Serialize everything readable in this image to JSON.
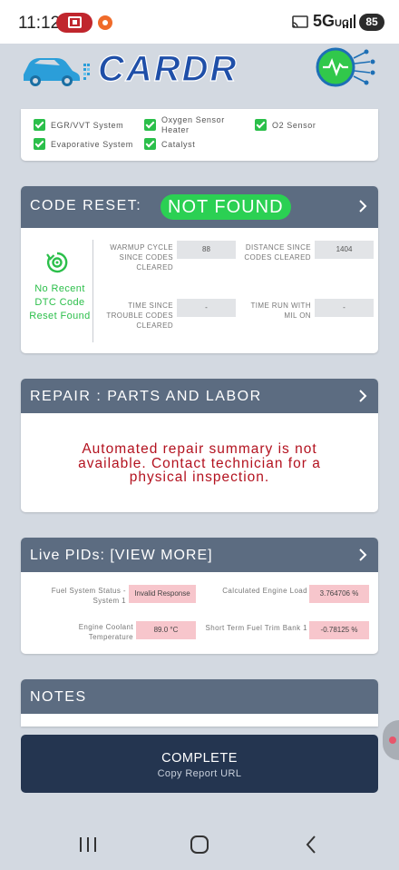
{
  "status_bar": {
    "time": "11:12",
    "network": "5G",
    "network_sub": "UC",
    "battery": "85"
  },
  "header": {
    "logo_text": "CARDR"
  },
  "monitors": [
    {
      "label": "EGR/VVT System"
    },
    {
      "label": "Oxygen Sensor Heater"
    },
    {
      "label": "O2 Sensor"
    },
    {
      "label": "Evaporative System"
    },
    {
      "label": "Catalyst"
    }
  ],
  "code_reset": {
    "title": "CODE RESET:",
    "status": "NOT FOUND",
    "message": "No Recent DTC Code Reset Found",
    "warmup_label": "WARMUP CYCLE SINCE CODES CLEARED",
    "warmup_value": "88",
    "distance_label": "DISTANCE SINCE CODES CLEARED",
    "distance_value": "1404",
    "time_since_label": "TIME SINCE TROUBLE CODES CLEARED",
    "time_since_value": "-",
    "time_mil_label": "TIME RUN WITH MIL ON",
    "time_mil_value": "-"
  },
  "repair": {
    "title": "REPAIR : PARTS AND LABOR",
    "message": "Automated repair summary is not available. Contact technician for a physical inspection."
  },
  "live_pids": {
    "title": "Live PIDs: [VIEW MORE]",
    "items": [
      {
        "label": "Fuel System Status - System 1",
        "value": "Invalid Response"
      },
      {
        "label": "Calculated Engine Load",
        "value": "3.764706 %"
      },
      {
        "label": "Engine Coolant Temperature",
        "value": "89.0 °C"
      },
      {
        "label": "Short Term Fuel Trim Bank 1",
        "value": "-0.78125 %"
      }
    ]
  },
  "notes": {
    "title": "NOTES"
  },
  "complete": {
    "label": "COMPLETE",
    "sub_label": "Copy Report URL"
  },
  "colors": {
    "card_header": "#5c6c81",
    "success_green": "#2bd053",
    "error_red": "#b3121f",
    "complete_bg": "#243550"
  }
}
